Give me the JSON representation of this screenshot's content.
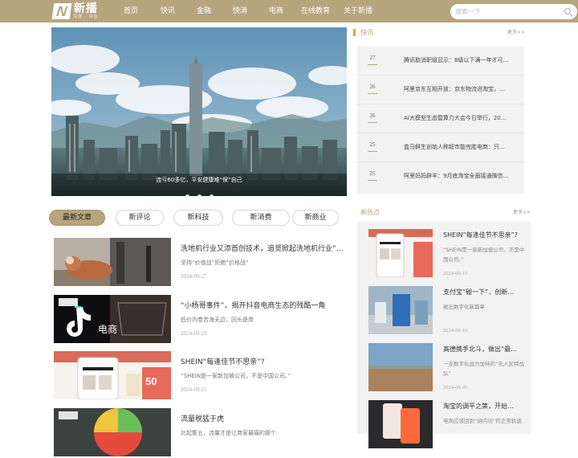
{
  "brand": {
    "logo_letter": "N",
    "name": "新播",
    "tagline": "深度 · 商业"
  },
  "nav": {
    "items": [
      {
        "label": "首页"
      },
      {
        "label": "快讯"
      },
      {
        "label": "金融"
      },
      {
        "label": "快消"
      },
      {
        "label": "电商"
      },
      {
        "label": "在线教育"
      },
      {
        "label": "关于新播"
      }
    ]
  },
  "search": {
    "placeholder": "搜索一下",
    "icon": "search-icon"
  },
  "banner": {
    "caption": "连亏60多亿，平安健康难“保”自己",
    "slide_count": 3,
    "active_slide": 1
  },
  "tabs": [
    {
      "label": "最新文章",
      "active": true
    },
    {
      "label": "新评论",
      "active": false
    },
    {
      "label": "新科技",
      "active": false
    },
    {
      "label": "新消费",
      "active": false
    },
    {
      "label": "新商业",
      "active": false
    }
  ],
  "articles": [
    {
      "title": "洗地机行业又添首创技术，追觅掀起洗地机行业“…",
      "desc": "坚持“价值战”拒绝“价格战”",
      "date": "2024-09-27"
    },
    {
      "title": "“小杨哥事件”，揭开抖音电商生态的残酷一角",
      "desc": "低价内卷苦海无边，回头是岸",
      "date": "2024-09-23"
    },
    {
      "title": "SHEIN“每逢佳节不思亲”?",
      "desc": "“SHEIN是一家新加坡公司，不是中国公司。”",
      "date": "2024-09-15"
    },
    {
      "title": "流量税猛于虎",
      "desc": "比起集五，流量才是让商家最痛的那个",
      "date": ""
    }
  ],
  "flash": {
    "title": "快讯",
    "more": "更多>>",
    "items": [
      {
        "day": "27",
        "text": "腾讯取消职级显示：8级以下满一年才可…"
      },
      {
        "day": "26",
        "text": "阿里京东互相开放：京东物流进淘宝，…"
      },
      {
        "day": "26",
        "text": "AI大模型生态暨算力大会今日举行，20…"
      },
      {
        "day": "25",
        "text": "盒马鲜生创始人称超市能完胜电商：只…"
      },
      {
        "day": "25",
        "text": "阿里妈妈辟羊：9月底淘宝全面接通微信…"
      }
    ]
  },
  "hot": {
    "title": "新热点",
    "more": "更多>>",
    "items": [
      {
        "title": "SHEIN“每逢佳节不思亲”?",
        "desc": "“SHEIN是一家新加坡公司，不是中国公司。”",
        "date": "2024-09-15"
      },
      {
        "title": "支付宝“碰一下”，创新…",
        "desc": "碰出数字化新篇章",
        "date": "2024-09-10"
      },
      {
        "title": "高德携手北斗，做出“最…",
        "desc": "一支数字化战力加持的“无人区特战队”",
        "date": "2024-09-05"
      },
      {
        "title": "淘宝的调平之策，开始…",
        "desc": "电商应该回到“拼内功”的正常轨道",
        "date": ""
      }
    ]
  },
  "colors": {
    "brand_gold": "#b7a57e",
    "accent_orange": "#d9a93a",
    "sidebar_bg": "#f2f2f2"
  }
}
